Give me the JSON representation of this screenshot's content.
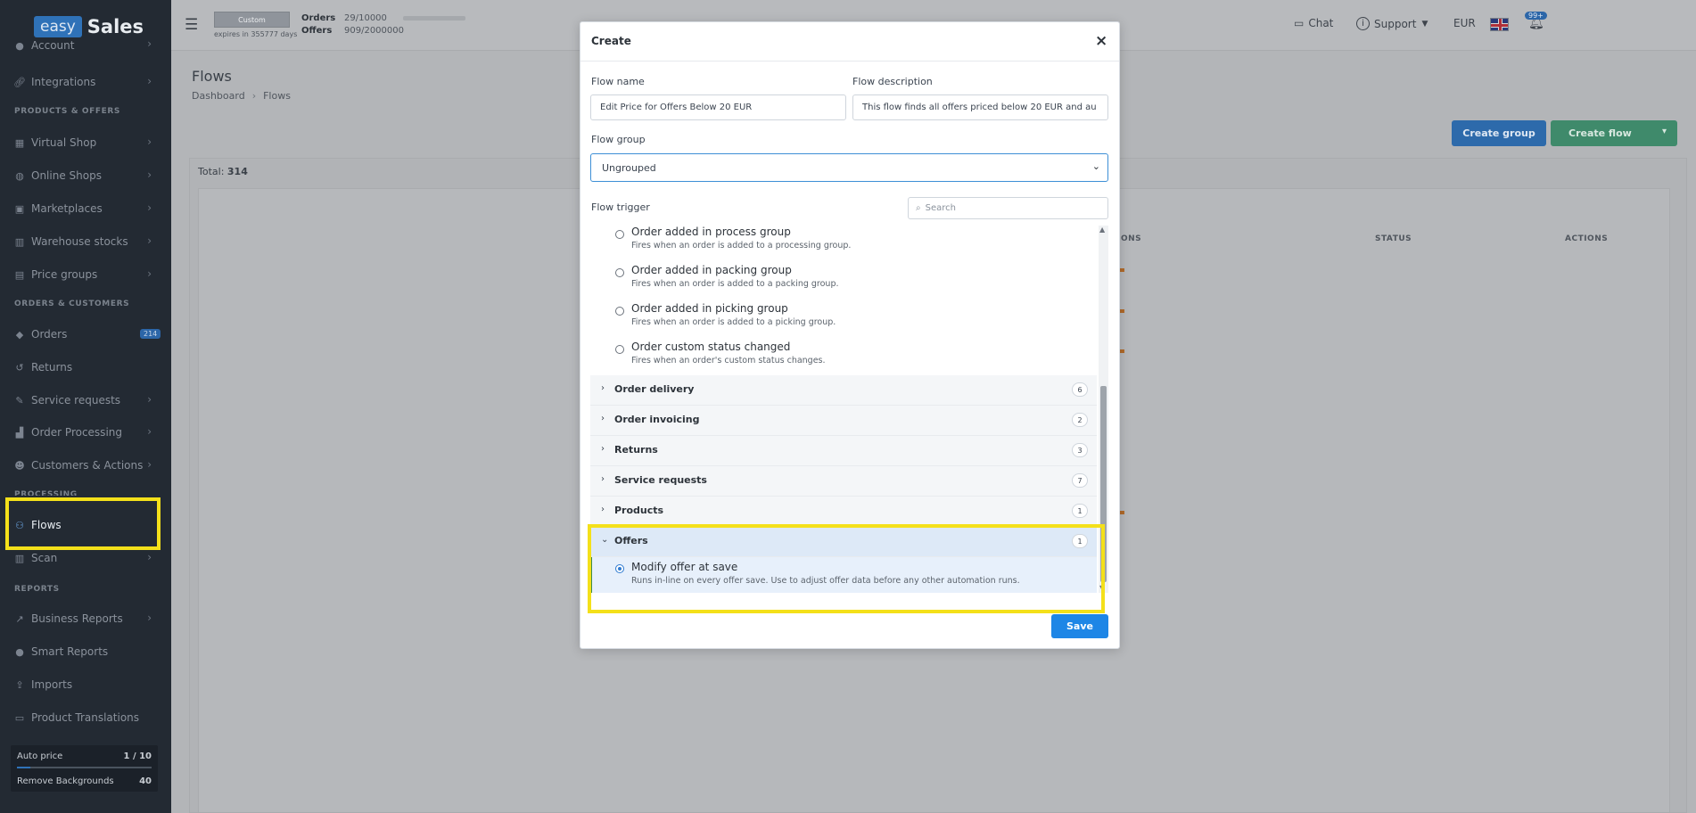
{
  "sidebar": {
    "logo_easy": "easy",
    "logo_sales": "Sales",
    "sections": {
      "products_offers": "PRODUCTS & OFFERS",
      "orders_customers": "ORDERS & CUSTOMERS",
      "processing": "PROCESSING",
      "reports": "REPORTS"
    },
    "items": {
      "account": "Account",
      "integrations": "Integrations",
      "virtual_shop": "Virtual Shop",
      "online_shops": "Online Shops",
      "marketplaces": "Marketplaces",
      "warehouse_stocks": "Warehouse stocks",
      "price_groups": "Price groups",
      "orders": "Orders",
      "orders_badge": "214",
      "returns": "Returns",
      "service_requests": "Service requests",
      "order_processing": "Order Processing",
      "customers_actions": "Customers & Actions",
      "flows": "Flows",
      "scan": "Scan",
      "business_reports": "Business Reports",
      "smart_reports": "Smart Reports",
      "imports": "Imports",
      "product_translations": "Product Translations"
    },
    "bottom": {
      "auto_price_label": "Auto price",
      "auto_price_value": "1 / 10",
      "auto_price_fraction": 0.1,
      "remove_bg_label": "Remove Backgrounds",
      "remove_bg_value": "40"
    }
  },
  "topbar": {
    "plan": "Custom",
    "expires": "expires in 355777 days",
    "orders_label": "Orders",
    "orders_value": "29/10000",
    "offers_label": "Offers",
    "offers_value": "909/2000000",
    "chat": "Chat",
    "support": "Support",
    "currency": "EUR",
    "notif_badge": "99+"
  },
  "page": {
    "title": "Flows",
    "breadcrumb_home": "Dashboard",
    "breadcrumb_current": "Flows",
    "create_group": "Create group",
    "create_flow": "Create flow",
    "total_label": "Total:",
    "total_value": "314",
    "col_actions_partial": "ONS",
    "col_status": "STATUS",
    "col_actions": "ACTIONS"
  },
  "modal": {
    "title": "Create",
    "flow_name_label": "Flow name",
    "flow_name_value": "Edit Price for Offers Below 20 EUR",
    "flow_desc_label": "Flow description",
    "flow_desc_value": "This flow finds all offers priced below 20 EUR and au",
    "flow_group_label": "Flow group",
    "flow_group_value": "Ungrouped",
    "flow_trigger_label": "Flow trigger",
    "search_placeholder": "Search",
    "triggers": [
      {
        "title": "Order added in process group",
        "desc": "Fires when an order is added to a processing group."
      },
      {
        "title": "Order added in packing group",
        "desc": "Fires when an order is added to a packing group."
      },
      {
        "title": "Order added in picking group",
        "desc": "Fires when an order is added to a picking group."
      },
      {
        "title": "Order custom status changed",
        "desc": "Fires when an order's custom status changes."
      }
    ],
    "categories": [
      {
        "name": "Order delivery",
        "count": "6"
      },
      {
        "name": "Order invoicing",
        "count": "2"
      },
      {
        "name": "Returns",
        "count": "3"
      },
      {
        "name": "Service requests",
        "count": "7"
      },
      {
        "name": "Products",
        "count": "1"
      },
      {
        "name": "Offers",
        "count": "1"
      }
    ],
    "offer_trigger": {
      "title": "Modify offer at save",
      "desc": "Runs in-line on every offer save. Use to adjust offer data before any other automation runs."
    },
    "save": "Save"
  },
  "colors": {
    "sidebar_bg": "#232a33",
    "primary": "#1e86e6",
    "highlight": "#f4e01a",
    "success": "#3f8a6b"
  }
}
